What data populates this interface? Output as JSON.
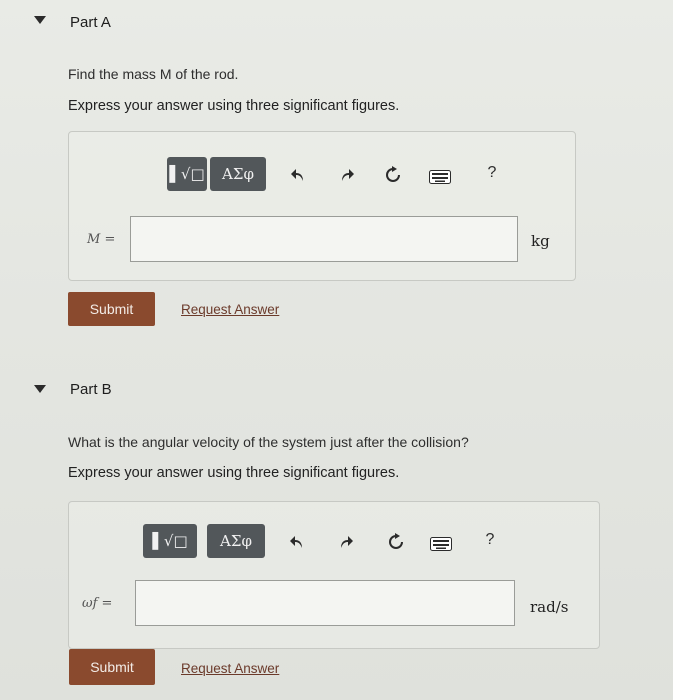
{
  "parts": [
    {
      "title": "Part A",
      "question": "Find the mass M of the rod.",
      "instruction": "Express your answer using three significant figures.",
      "toolbar": {
        "templates_label": "▌√□",
        "greek_label": "ΑΣφ",
        "help_label": "?"
      },
      "answer": {
        "variable_label": "M =",
        "value": "",
        "unit": "kg"
      },
      "submit_label": "Submit",
      "request_answer_label": "Request Answer"
    },
    {
      "title": "Part B",
      "question": "What is the angular velocity of the system just after the collision?",
      "instruction": "Express your answer using three significant figures.",
      "toolbar": {
        "templates_label": "▌√□",
        "greek_label": "ΑΣφ",
        "help_label": "?"
      },
      "answer": {
        "variable_label": "ωf =",
        "value": "",
        "unit": "rad/s"
      },
      "submit_label": "Submit",
      "request_answer_label": "Request Answer"
    }
  ],
  "colors": {
    "submit_bg": "#8a4a2e",
    "toolbar_button_bg": "#52575a",
    "link_color": "#6b3a2a"
  },
  "icons": [
    "collapse-triangle-icon",
    "undo-icon",
    "redo-icon",
    "reset-icon",
    "keyboard-icon",
    "help-icon"
  ]
}
